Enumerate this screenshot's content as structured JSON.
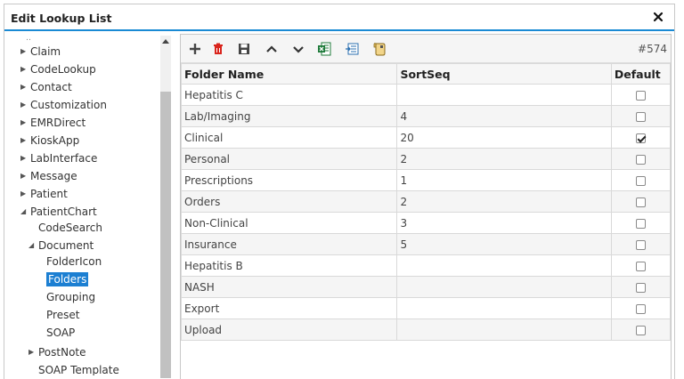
{
  "dialog": {
    "title": "Edit Lookup List"
  },
  "tree": {
    "items": [
      {
        "label": "Claim",
        "arrow": "right"
      },
      {
        "label": "CodeLookup",
        "arrow": "right"
      },
      {
        "label": "Contact",
        "arrow": "right"
      },
      {
        "label": "Customization",
        "arrow": "right"
      },
      {
        "label": "EMRDirect",
        "arrow": "right"
      },
      {
        "label": "KioskApp",
        "arrow": "right"
      },
      {
        "label": "LabInterface",
        "arrow": "right"
      },
      {
        "label": "Message",
        "arrow": "right"
      },
      {
        "label": "Patient",
        "arrow": "right"
      },
      {
        "label": "PatientChart",
        "arrow": "down"
      },
      {
        "label": "CodeSearch",
        "arrow": "none"
      },
      {
        "label": "Document",
        "arrow": "down"
      },
      {
        "label": "FolderIcon",
        "arrow": "none"
      },
      {
        "label": "Folders",
        "arrow": "none"
      },
      {
        "label": "Grouping",
        "arrow": "none"
      },
      {
        "label": "Preset",
        "arrow": "none"
      },
      {
        "label": "SOAP",
        "arrow": "none"
      },
      {
        "label": "PostNote",
        "arrow": "right"
      },
      {
        "label": "SOAP Template",
        "arrow": "none"
      }
    ],
    "selected": "Folders"
  },
  "toolbar": {
    "buttons": [
      "add-icon",
      "delete-icon",
      "save-icon",
      "move-up-icon",
      "move-down-icon",
      "export-excel-icon",
      "import-icon",
      "scroll-icon"
    ],
    "record_count": "#574"
  },
  "table": {
    "headers": [
      "Folder Name",
      "SortSeq",
      "Default"
    ],
    "rows": [
      {
        "name": "Hepatitis C",
        "sort": "",
        "default": false
      },
      {
        "name": "Lab/Imaging",
        "sort": "4",
        "default": false
      },
      {
        "name": "Clinical",
        "sort": "20",
        "default": true
      },
      {
        "name": "Personal",
        "sort": "2",
        "default": false
      },
      {
        "name": "Prescriptions",
        "sort": "1",
        "default": false
      },
      {
        "name": "Orders",
        "sort": "2",
        "default": false
      },
      {
        "name": "Non-Clinical",
        "sort": "3",
        "default": false
      },
      {
        "name": "Insurance",
        "sort": "5",
        "default": false
      },
      {
        "name": "Hepatitis B",
        "sort": "",
        "default": false
      },
      {
        "name": "NASH",
        "sort": "",
        "default": false
      },
      {
        "name": "Export",
        "sort": "",
        "default": false
      },
      {
        "name": "Upload",
        "sort": "",
        "default": false
      }
    ]
  },
  "colors": {
    "accent": "#1a8ad4",
    "selected": "#1c7fd2",
    "delete": "#d9241c",
    "excel": "#1e7a3a"
  }
}
